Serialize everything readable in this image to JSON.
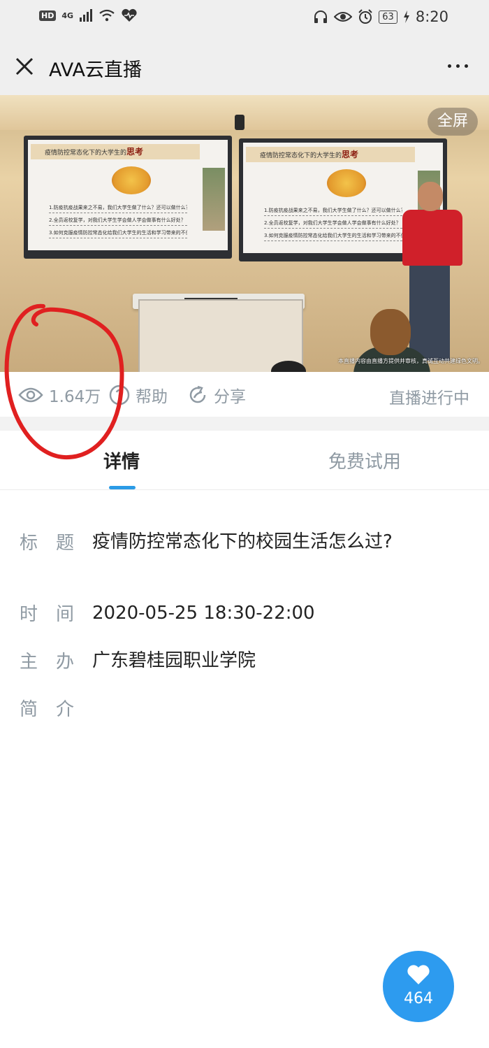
{
  "status_bar": {
    "hd": "HD",
    "network": "4G",
    "battery": "63",
    "time": "8:20"
  },
  "header": {
    "title": "AVA云直播"
  },
  "video": {
    "fullscreen_label": "全屏",
    "slide_title_prefix": "疫情防控常态化下的大学生的",
    "slide_title_emph": "思考",
    "slide_lines": [
      "1.防疫抗疫战果来之不易，我们大学生做了什么？还可以做什么？",
      "2.全员返校复学，对我们大学生学会做人学会做事有什么好处？",
      "3.如何克服疫情防控常态化给我们大学生的生活和学习带来的不便？"
    ],
    "subtitle": "本直播内容由直播方提供并审核，真诚互动共建绿色文明。"
  },
  "stats": {
    "views": "1.64万",
    "help_label": "帮助",
    "share_label": "分享",
    "live_status": "直播进行中"
  },
  "tabs": {
    "detail": "详情",
    "trial": "免费试用"
  },
  "details": {
    "title_label_1": "标",
    "title_label_2": "题",
    "title_value": "疫情防控常态化下的校园生活怎么过?",
    "time_label_1": "时",
    "time_label_2": "间",
    "time_value": "2020-05-25 18:30-22:00",
    "host_label_1": "主",
    "host_label_2": "办",
    "host_value": "广东碧桂园职业学院",
    "intro_label_1": "简",
    "intro_label_2": "介"
  },
  "like": {
    "count": "464",
    "color": "#2d9bef"
  },
  "colors": {
    "accent": "#2b9be6",
    "muted": "#8f9aa3",
    "annotation": "#e02020"
  }
}
